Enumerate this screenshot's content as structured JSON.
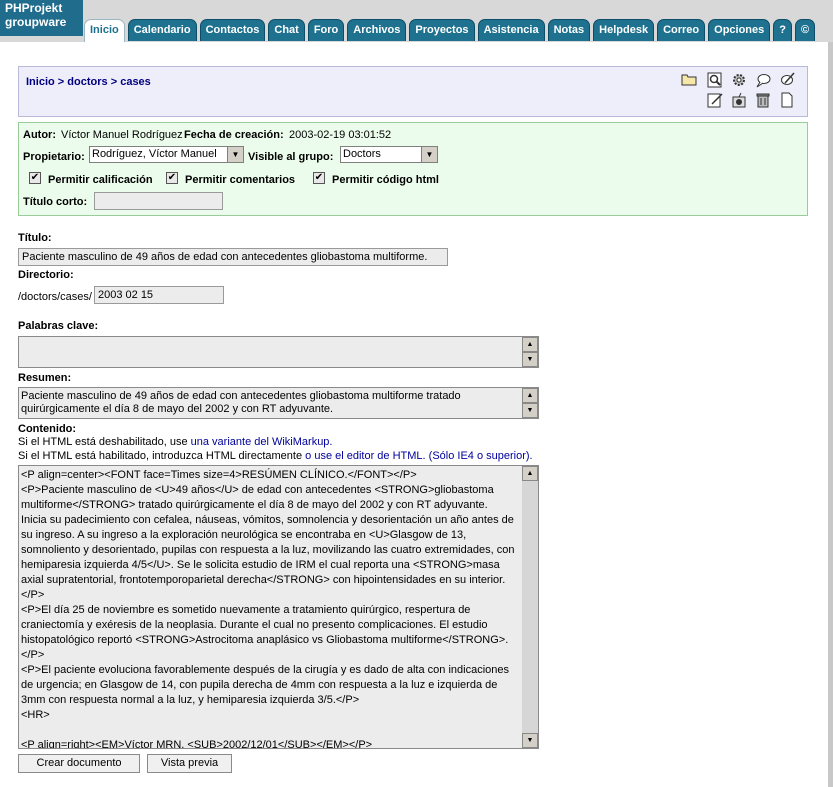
{
  "logo": {
    "line1": "PHProjekt",
    "line2": "groupware"
  },
  "tabs": [
    {
      "label": "Inicio",
      "active": true
    },
    {
      "label": "Calendario"
    },
    {
      "label": "Contactos"
    },
    {
      "label": "Chat"
    },
    {
      "label": "Foro"
    },
    {
      "label": "Archivos"
    },
    {
      "label": "Proyectos"
    },
    {
      "label": "Asistencia"
    },
    {
      "label": "Notas"
    },
    {
      "label": "Helpdesk"
    },
    {
      "label": "Correo"
    },
    {
      "label": "Opciones"
    },
    {
      "label": "?"
    },
    {
      "label": "©"
    }
  ],
  "breadcrumb": {
    "home": "Inicio",
    "sep": ">",
    "level1": "doctors",
    "level2": "cases"
  },
  "toolbar_icons": [
    "folder-icon",
    "magnifier-icon",
    "gear-icon",
    "speech-bubble-icon",
    "edit-bubble-icon",
    "notepad-icon",
    "bomb-icon",
    "trash-icon",
    "new-page-icon"
  ],
  "meta": {
    "author_label": "Autor:",
    "author": "Víctor Manuel Rodríguez",
    "created_label": "Fecha de creación:",
    "created": "2003-02-19 03:01:52",
    "owner_label": "Propietario:",
    "owner": "Rodríguez, Víctor Manuel",
    "group_label": "Visible al grupo:",
    "group": "Doctors",
    "allow_rating": "Permitir calificación",
    "allow_comments": "Permitir comentarios",
    "allow_html": "Permitir código html",
    "short_title_label": "Título corto:",
    "short_title": ""
  },
  "form": {
    "title_label": "Título:",
    "title": "Paciente masculino de 49 años de edad con antecedentes gliobastoma multiforme.",
    "dir_label": "Directorio:",
    "dir_prefix": "/doctors/cases/",
    "dir_value": "2003 02 15",
    "keywords_label": "Palabras clave:",
    "keywords": "",
    "summary_label": "Resumen:",
    "summary": "Paciente masculino de 49 años de edad con antecedentes gliobastoma multiforme tratado quirúrgicamente el día 8 de mayo del 2002 y con RT adyuvante.",
    "content_label": "Contenido:",
    "help_line1_pre": "Si el HTML está deshabilitado, use ",
    "help_line1_link": "una variante del WikiMarkup.",
    "help_line2_pre": "Si el HTML está habilitado, introduzca HTML directamente ",
    "help_line2_link": "o use el editor de HTML. (Sólo IE4 o superior).",
    "content": "<P align=center><FONT face=Times size=4>RESÚMEN CLÍNICO.</FONT></P>\n<P>Paciente masculino de <U>49 años</U> de edad con antecedentes <STRONG>gliobastoma multiforme</STRONG> tratado quirúrgicamente el día 8 de mayo del 2002 y con RT adyuvante. Inicia su padecimiento con cefalea, náuseas, vómitos, somnolencia y desorientación un año antes de su ingreso. A su ingreso a la exploración neurológica se encontraba en <U>Glasgow de 13, somnoliento y desorientado, pupilas con respuesta a la luz, movilizando las cuatro extremidades, con hemiparesia izquierda 4/5</U>. Se le solicita estudio de IRM el cual reporta una <STRONG>masa axial supratentorial, frontotemporoparietal derecha</STRONG> con hipointensidades en su interior. </P>\n<P>El día 25 de noviembre es sometido nuevamente a tratamiento quirúrgico, respertura de craniectomía y exéresis de la neoplasia. Durante el cual no presento complicaciones. El estudio histopatológico reportó <STRONG>Astrocitoma anaplásico vs Gliobastoma multiforme</STRONG>. </P>\n<P>El paciente evoluciona favorablemente después de la cirugía y es dado de alta con indicaciones de urgencia; en Glasgow de 14, con pupila derecha de 4mm con respuesta a la luz e izquierda de 3mm con respuesta normal a la luz, y hemiparesia izquierda 3/5.</P>\n<HR>\n\n<P align=right><EM>Víctor MRN, <SUB>2002/12/01</SUB></EM></P>",
    "create_button": "Crear documento",
    "preview_button": "Vista previa"
  }
}
